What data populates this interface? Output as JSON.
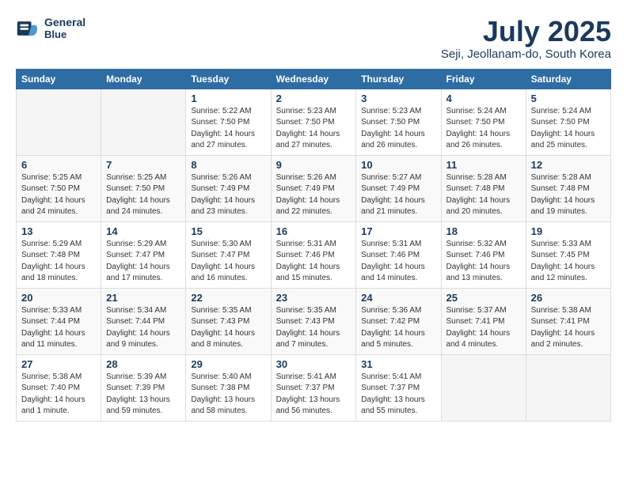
{
  "header": {
    "logo_line1": "General",
    "logo_line2": "Blue",
    "month_title": "July 2025",
    "location": "Seji, Jeollanam-do, South Korea"
  },
  "weekdays": [
    "Sunday",
    "Monday",
    "Tuesday",
    "Wednesday",
    "Thursday",
    "Friday",
    "Saturday"
  ],
  "weeks": [
    [
      {
        "day": "",
        "info": ""
      },
      {
        "day": "",
        "info": ""
      },
      {
        "day": "1",
        "info": "Sunrise: 5:22 AM\nSunset: 7:50 PM\nDaylight: 14 hours and 27 minutes."
      },
      {
        "day": "2",
        "info": "Sunrise: 5:23 AM\nSunset: 7:50 PM\nDaylight: 14 hours and 27 minutes."
      },
      {
        "day": "3",
        "info": "Sunrise: 5:23 AM\nSunset: 7:50 PM\nDaylight: 14 hours and 26 minutes."
      },
      {
        "day": "4",
        "info": "Sunrise: 5:24 AM\nSunset: 7:50 PM\nDaylight: 14 hours and 26 minutes."
      },
      {
        "day": "5",
        "info": "Sunrise: 5:24 AM\nSunset: 7:50 PM\nDaylight: 14 hours and 25 minutes."
      }
    ],
    [
      {
        "day": "6",
        "info": "Sunrise: 5:25 AM\nSunset: 7:50 PM\nDaylight: 14 hours and 24 minutes."
      },
      {
        "day": "7",
        "info": "Sunrise: 5:25 AM\nSunset: 7:50 PM\nDaylight: 14 hours and 24 minutes."
      },
      {
        "day": "8",
        "info": "Sunrise: 5:26 AM\nSunset: 7:49 PM\nDaylight: 14 hours and 23 minutes."
      },
      {
        "day": "9",
        "info": "Sunrise: 5:26 AM\nSunset: 7:49 PM\nDaylight: 14 hours and 22 minutes."
      },
      {
        "day": "10",
        "info": "Sunrise: 5:27 AM\nSunset: 7:49 PM\nDaylight: 14 hours and 21 minutes."
      },
      {
        "day": "11",
        "info": "Sunrise: 5:28 AM\nSunset: 7:48 PM\nDaylight: 14 hours and 20 minutes."
      },
      {
        "day": "12",
        "info": "Sunrise: 5:28 AM\nSunset: 7:48 PM\nDaylight: 14 hours and 19 minutes."
      }
    ],
    [
      {
        "day": "13",
        "info": "Sunrise: 5:29 AM\nSunset: 7:48 PM\nDaylight: 14 hours and 18 minutes."
      },
      {
        "day": "14",
        "info": "Sunrise: 5:29 AM\nSunset: 7:47 PM\nDaylight: 14 hours and 17 minutes."
      },
      {
        "day": "15",
        "info": "Sunrise: 5:30 AM\nSunset: 7:47 PM\nDaylight: 14 hours and 16 minutes."
      },
      {
        "day": "16",
        "info": "Sunrise: 5:31 AM\nSunset: 7:46 PM\nDaylight: 14 hours and 15 minutes."
      },
      {
        "day": "17",
        "info": "Sunrise: 5:31 AM\nSunset: 7:46 PM\nDaylight: 14 hours and 14 minutes."
      },
      {
        "day": "18",
        "info": "Sunrise: 5:32 AM\nSunset: 7:46 PM\nDaylight: 14 hours and 13 minutes."
      },
      {
        "day": "19",
        "info": "Sunrise: 5:33 AM\nSunset: 7:45 PM\nDaylight: 14 hours and 12 minutes."
      }
    ],
    [
      {
        "day": "20",
        "info": "Sunrise: 5:33 AM\nSunset: 7:44 PM\nDaylight: 14 hours and 11 minutes."
      },
      {
        "day": "21",
        "info": "Sunrise: 5:34 AM\nSunset: 7:44 PM\nDaylight: 14 hours and 9 minutes."
      },
      {
        "day": "22",
        "info": "Sunrise: 5:35 AM\nSunset: 7:43 PM\nDaylight: 14 hours and 8 minutes."
      },
      {
        "day": "23",
        "info": "Sunrise: 5:35 AM\nSunset: 7:43 PM\nDaylight: 14 hours and 7 minutes."
      },
      {
        "day": "24",
        "info": "Sunrise: 5:36 AM\nSunset: 7:42 PM\nDaylight: 14 hours and 5 minutes."
      },
      {
        "day": "25",
        "info": "Sunrise: 5:37 AM\nSunset: 7:41 PM\nDaylight: 14 hours and 4 minutes."
      },
      {
        "day": "26",
        "info": "Sunrise: 5:38 AM\nSunset: 7:41 PM\nDaylight: 14 hours and 2 minutes."
      }
    ],
    [
      {
        "day": "27",
        "info": "Sunrise: 5:38 AM\nSunset: 7:40 PM\nDaylight: 14 hours and 1 minute."
      },
      {
        "day": "28",
        "info": "Sunrise: 5:39 AM\nSunset: 7:39 PM\nDaylight: 13 hours and 59 minutes."
      },
      {
        "day": "29",
        "info": "Sunrise: 5:40 AM\nSunset: 7:38 PM\nDaylight: 13 hours and 58 minutes."
      },
      {
        "day": "30",
        "info": "Sunrise: 5:41 AM\nSunset: 7:37 PM\nDaylight: 13 hours and 56 minutes."
      },
      {
        "day": "31",
        "info": "Sunrise: 5:41 AM\nSunset: 7:37 PM\nDaylight: 13 hours and 55 minutes."
      },
      {
        "day": "",
        "info": ""
      },
      {
        "day": "",
        "info": ""
      }
    ]
  ]
}
